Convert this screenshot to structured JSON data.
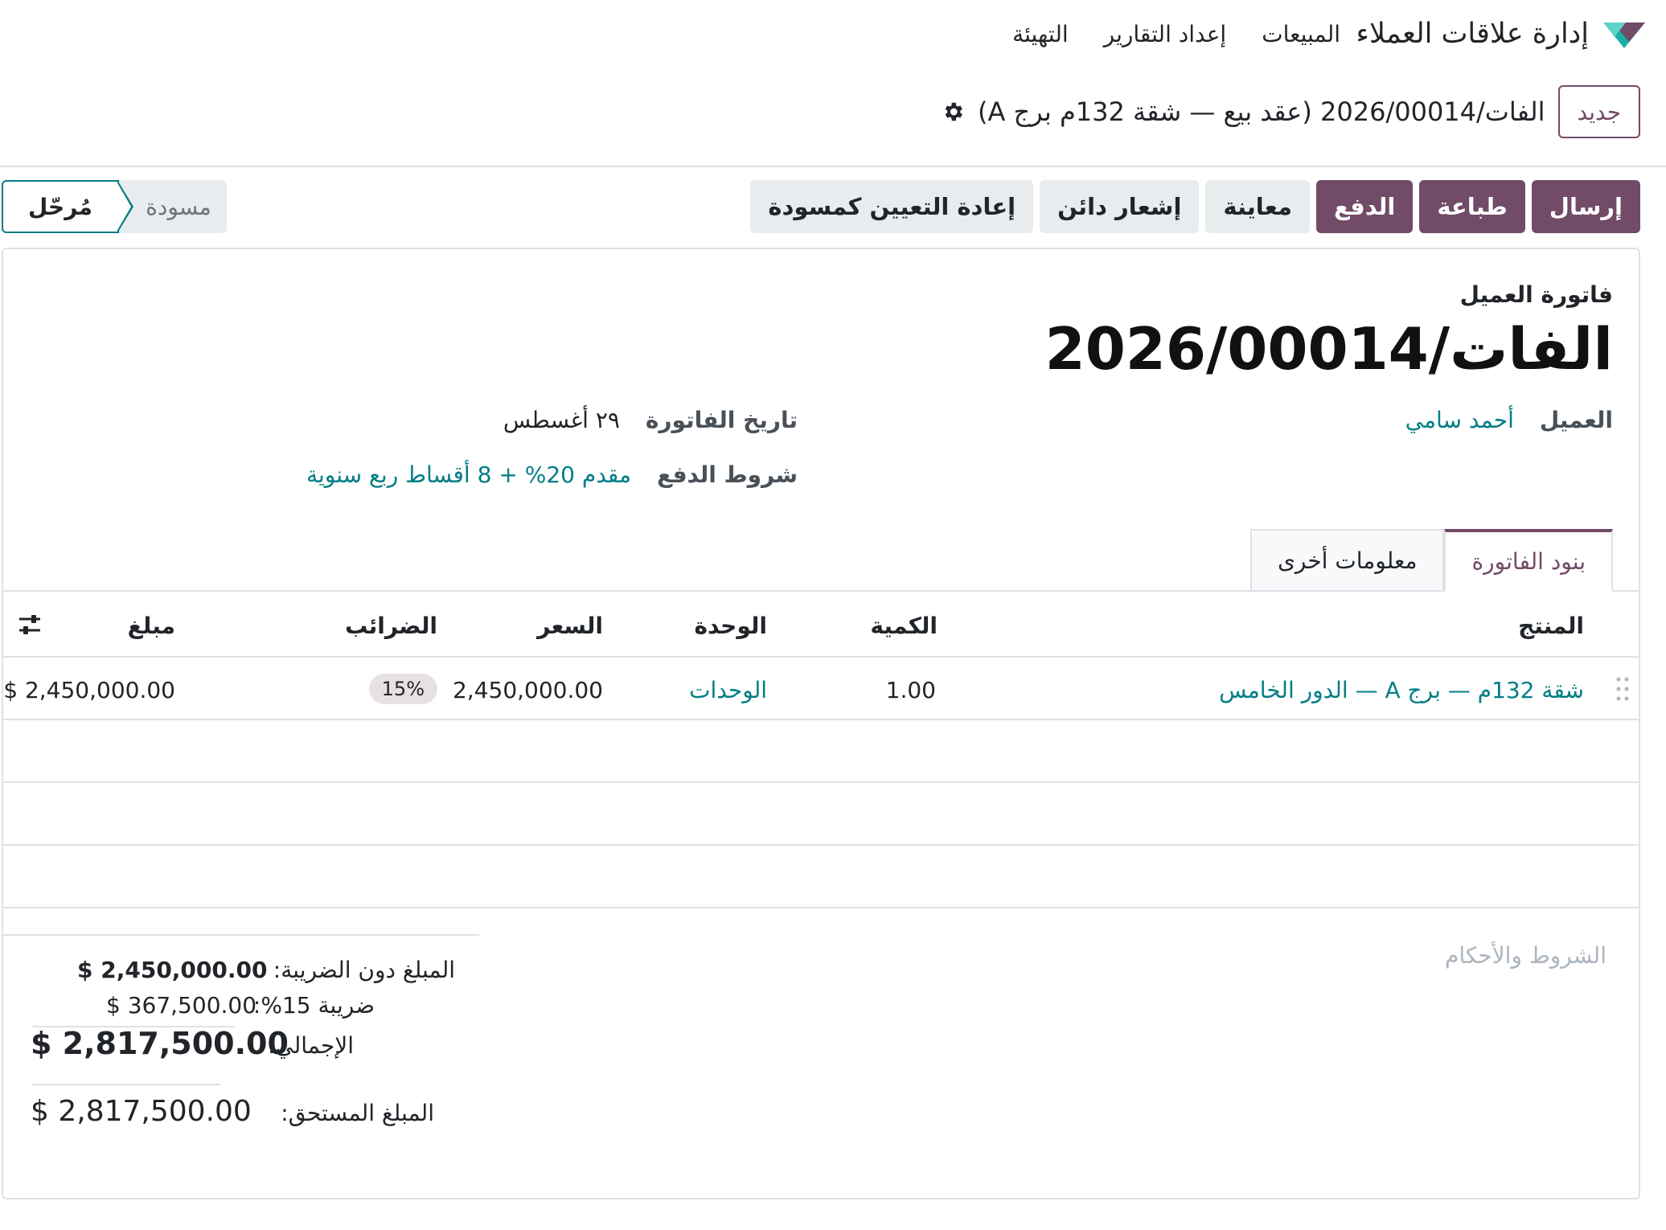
{
  "navbar": {
    "app_name": "إدارة علاقات العملاء",
    "menu": [
      "المبيعات",
      "إعداد التقارير",
      "التهيئة"
    ],
    "accent_color": "#714b67"
  },
  "breadcrumb": {
    "new_label": "جديد",
    "record_title": "الفات/2026/00014 (عقد بيع — شقة 132م برج A)"
  },
  "actions": {
    "send": "إرسال",
    "print": "طباعة",
    "pay": "الدفع",
    "preview": "معاينة",
    "credit_note": "إشعار دائن",
    "reset_to_draft": "إعادة التعيين كمسودة"
  },
  "status": {
    "draft": "مسودة",
    "posted": "مُرحّل",
    "current": "posted"
  },
  "invoice": {
    "type_label": "فاتورة العميل",
    "number": "الفات/2026/00014",
    "customer_label": "العميل",
    "customer": "أحمد سامي",
    "date_label": "تاريخ الفاتورة",
    "date": "٢٩ أغسطس",
    "payment_terms_label": "شروط الدفع",
    "payment_terms": "مقدم 20% + 8 أقساط ربع سنوية"
  },
  "tabs": {
    "lines": "بنود الفاتورة",
    "other": "معلومات أخرى"
  },
  "table": {
    "headers": {
      "product": "المنتج",
      "quantity": "الكمية",
      "unit": "الوحدة",
      "price": "السعر",
      "taxes": "الضرائب",
      "amount": "مبلغ"
    },
    "rows": [
      {
        "product": "شقة 132م — برج A — الدور الخامس",
        "quantity": "1.00",
        "unit": "الوحدات",
        "price": "2,450,000.00",
        "tax": "15%",
        "amount": "$ 2,450,000.00"
      }
    ]
  },
  "totals": {
    "terms_placeholder": "الشروط والأحكام",
    "untaxed_label": "المبلغ دون الضريبة:",
    "untaxed": "$ 2,450,000.00",
    "tax_label": "ضريبة 15%:",
    "tax": "$ 367,500.00",
    "total_label": "الإجمالي:",
    "total": "$ 2,817,500.00",
    "due_label": "المبلغ المستحق:",
    "due": "$ 2,817,500.00"
  }
}
